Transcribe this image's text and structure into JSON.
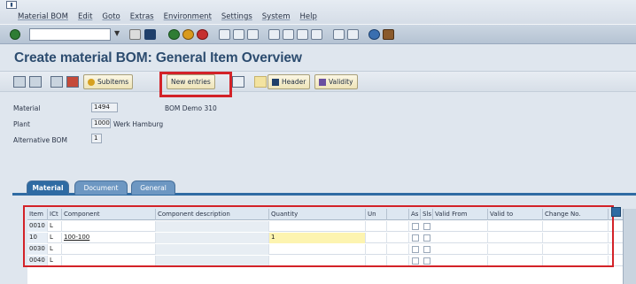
{
  "menu": {
    "items": [
      "Material BOM",
      "Edit",
      "Goto",
      "Extras",
      "Environment",
      "Settings",
      "System",
      "Help"
    ]
  },
  "toolbar": {
    "command_field_value": "",
    "command_dropdown": "▼"
  },
  "page": {
    "title": "Create material BOM: General Item Overview"
  },
  "app_toolbar": {
    "subitems_label": "Subitems",
    "new_entries_label": "New entries",
    "header_label": "Header",
    "validity_label": "Validity"
  },
  "header": {
    "material_label": "Material",
    "material_value": "1494",
    "material_desc": "BOM Demo 310",
    "plant_label": "Plant",
    "plant_value": "1000",
    "plant_desc": "Werk Hamburg",
    "alt_bom_label": "Alternative BOM",
    "alt_bom_value": "1"
  },
  "tabs": [
    "Material",
    "Document",
    "General"
  ],
  "grid": {
    "columns": [
      "Item",
      "ICt",
      "Component",
      "Component description",
      "Quantity",
      "Un",
      "As",
      "Sls",
      "Valid From",
      "Valid to",
      "Change No."
    ],
    "rows": [
      {
        "item": "0010",
        "ict": "L",
        "component": "",
        "quantity": ""
      },
      {
        "item": "10",
        "ict": "L",
        "component": "100-100",
        "quantity": "1"
      },
      {
        "item": "0030",
        "ict": "L",
        "component": "",
        "quantity": ""
      },
      {
        "item": "0040",
        "ict": "L",
        "component": "",
        "quantity": ""
      }
    ]
  },
  "colors": {
    "title": "#2c4c6f",
    "highlight": "#d32228",
    "tab_active": "#2f6ba3"
  }
}
